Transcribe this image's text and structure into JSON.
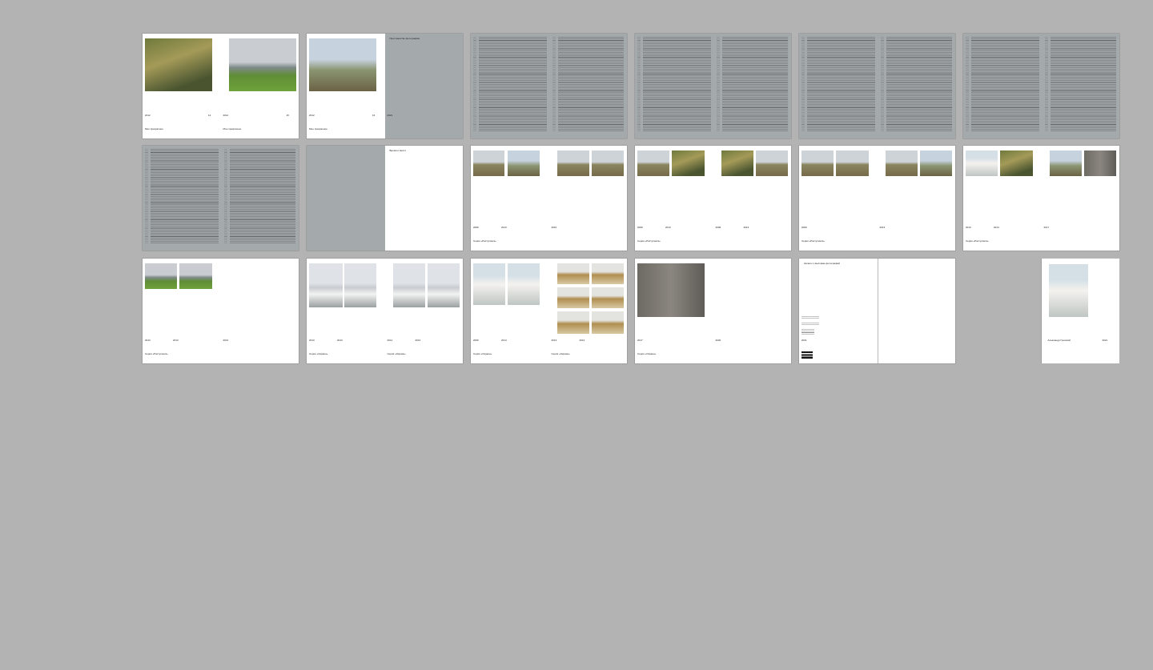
{
  "spreads": [
    {
      "row": 0,
      "col": 0,
      "bg": [
        "white",
        "white"
      ],
      "caps": [
        {
          "t": "2012",
          "side": "l",
          "pos": "year"
        },
        {
          "t": "14",
          "side": "l",
          "pos": "num"
        },
        {
          "t": "2012",
          "side": "r",
          "pos": "year"
        },
        {
          "t": "15",
          "side": "r",
          "pos": "num"
        },
        {
          "t": "Мое прекрасное",
          "side": "l",
          "pos": "series"
        },
        {
          "t": "Мое прекрасное",
          "side": "r",
          "pos": "series"
        }
      ]
    },
    {
      "row": 0,
      "col": 1,
      "bg": [
        "white",
        "gray"
      ],
      "caps": [
        {
          "t": "2012",
          "side": "l",
          "pos": "year"
        },
        {
          "t": "16",
          "side": "l",
          "pos": "num"
        },
        {
          "t": "2021",
          "side": "r",
          "pos": "year"
        },
        {
          "t": "Мое прекрасное",
          "side": "l",
          "pos": "series"
        },
        {
          "t": "Пространство фотографии",
          "side": "r",
          "pos": "top"
        }
      ]
    },
    {
      "row": 0,
      "col": 2,
      "bg": [
        "gray",
        "gray"
      ],
      "caps": []
    },
    {
      "row": 0,
      "col": 3,
      "bg": [
        "gray",
        "gray"
      ],
      "caps": []
    },
    {
      "row": 0,
      "col": 4,
      "bg": [
        "gray",
        "gray"
      ],
      "caps": []
    },
    {
      "row": 0,
      "col": 5,
      "bg": [
        "gray",
        "gray"
      ],
      "caps": []
    },
    {
      "row": 1,
      "col": 0,
      "bg": [
        "gray",
        "gray"
      ],
      "caps": []
    },
    {
      "row": 1,
      "col": 1,
      "bg": [
        "gray",
        "white"
      ],
      "caps": [
        {
          "t": "Время и место",
          "side": "r",
          "pos": "top"
        }
      ]
    },
    {
      "row": 1,
      "col": 2,
      "bg": [
        "white",
        "white"
      ],
      "caps": [
        {
          "t": "2009",
          "side": "l",
          "pos": "year"
        },
        {
          "t": "2013",
          "side": "l",
          "pos": "year2"
        },
        {
          "t": "2016",
          "side": "r",
          "pos": "year"
        },
        {
          "t": "Серия «Раступинск»",
          "side": "l",
          "pos": "series"
        }
      ]
    },
    {
      "row": 1,
      "col": 3,
      "bg": [
        "white",
        "white"
      ],
      "caps": [
        {
          "t": "2009",
          "side": "l",
          "pos": "year"
        },
        {
          "t": "2013",
          "side": "l",
          "pos": "year2"
        },
        {
          "t": "2009",
          "side": "r",
          "pos": "year"
        },
        {
          "t": "2013",
          "side": "r",
          "pos": "year2"
        },
        {
          "t": "Серия «Раступинск»",
          "side": "l",
          "pos": "series"
        }
      ]
    },
    {
      "row": 1,
      "col": 4,
      "bg": [
        "white",
        "white"
      ],
      "caps": [
        {
          "t": "2009",
          "side": "l",
          "pos": "year"
        },
        {
          "t": "2013",
          "side": "r",
          "pos": "year"
        },
        {
          "t": "Серия «Раступинск»",
          "side": "l",
          "pos": "series"
        }
      ]
    },
    {
      "row": 1,
      "col": 5,
      "bg": [
        "white",
        "white"
      ],
      "caps": [
        {
          "t": "2013",
          "side": "l",
          "pos": "year"
        },
        {
          "t": "2014",
          "side": "l",
          "pos": "year2"
        },
        {
          "t": "2017",
          "side": "r",
          "pos": "year"
        },
        {
          "t": "Серия «Раступинск»",
          "side": "l",
          "pos": "series"
        }
      ]
    },
    {
      "row": 2,
      "col": 0,
      "bg": [
        "white",
        "white"
      ],
      "caps": [
        {
          "t": "2013",
          "side": "l",
          "pos": "year"
        },
        {
          "t": "2013",
          "side": "l",
          "pos": "year2"
        },
        {
          "t": "2013",
          "side": "r",
          "pos": "year"
        },
        {
          "t": "Серия «Раступинск»",
          "side": "l",
          "pos": "series"
        }
      ]
    },
    {
      "row": 2,
      "col": 1,
      "bg": [
        "white",
        "white"
      ],
      "caps": [
        {
          "t": "2013",
          "side": "l",
          "pos": "year"
        },
        {
          "t": "2013",
          "side": "l",
          "pos": "year2"
        },
        {
          "t": "2014",
          "side": "r",
          "pos": "year"
        },
        {
          "t": "2013",
          "side": "r",
          "pos": "year2"
        },
        {
          "t": "Серия «Окраин»",
          "side": "l",
          "pos": "series"
        },
        {
          "t": "Серия «Окраин»",
          "side": "r",
          "pos": "series"
        }
      ]
    },
    {
      "row": 2,
      "col": 2,
      "bg": [
        "white",
        "white"
      ],
      "caps": [
        {
          "t": "2009",
          "side": "l",
          "pos": "year"
        },
        {
          "t": "2014",
          "side": "l",
          "pos": "year2"
        },
        {
          "t": "2013",
          "side": "r",
          "pos": "year"
        },
        {
          "t": "2013",
          "side": "r",
          "pos": "year2"
        },
        {
          "t": "Серия «Окраин»",
          "side": "l",
          "pos": "series"
        },
        {
          "t": "Серия «Окраин»",
          "side": "r",
          "pos": "series"
        }
      ]
    },
    {
      "row": 2,
      "col": 3,
      "bg": [
        "white",
        "white"
      ],
      "caps": [
        {
          "t": "2017",
          "side": "l",
          "pos": "year"
        },
        {
          "t": "2020",
          "side": "r",
          "pos": "year"
        },
        {
          "t": "Серия «Окраин»",
          "side": "l",
          "pos": "series"
        }
      ]
    },
    {
      "row": 2,
      "col": 4,
      "bg": [
        "white",
        "white"
      ],
      "caps": [
        {
          "t": "Каталог к выставке фотографий",
          "side": "l",
          "pos": "top"
        },
        {
          "t": "2021",
          "side": "l",
          "pos": "year"
        }
      ]
    },
    {
      "row": 2,
      "col": 5,
      "bg": [
        "none",
        "white"
      ],
      "caps": [
        {
          "t": "Александр Гронский",
          "side": "r",
          "pos": "series2"
        },
        {
          "t": "2021",
          "side": "r",
          "pos": "numr"
        }
      ]
    }
  ]
}
